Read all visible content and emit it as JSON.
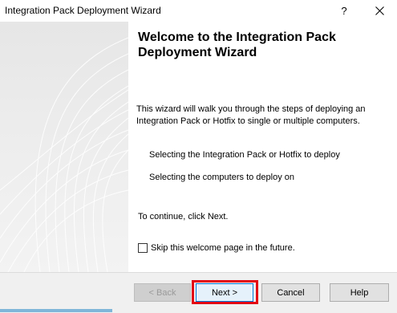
{
  "window": {
    "title": "Integration Pack Deployment Wizard",
    "help_glyph": "?",
    "close_icon": "close-icon"
  },
  "welcome": {
    "heading": "Welcome to the Integration Pack Deployment Wizard",
    "intro": "This wizard will walk you through the steps of deploying an Integration Pack or Hotfix to single or multiple computers.",
    "steps": [
      "Selecting the Integration Pack or Hotfix to deploy",
      "Selecting the computers to deploy on"
    ],
    "continue_text": "To continue, click Next.",
    "skip_label": "Skip this welcome page in the future.",
    "skip_checked": false
  },
  "buttons": {
    "back": "< Back",
    "next": "Next >",
    "cancel": "Cancel",
    "help": "Help"
  },
  "colors": {
    "highlight": "#e30613",
    "focus_border": "#0078d7"
  }
}
